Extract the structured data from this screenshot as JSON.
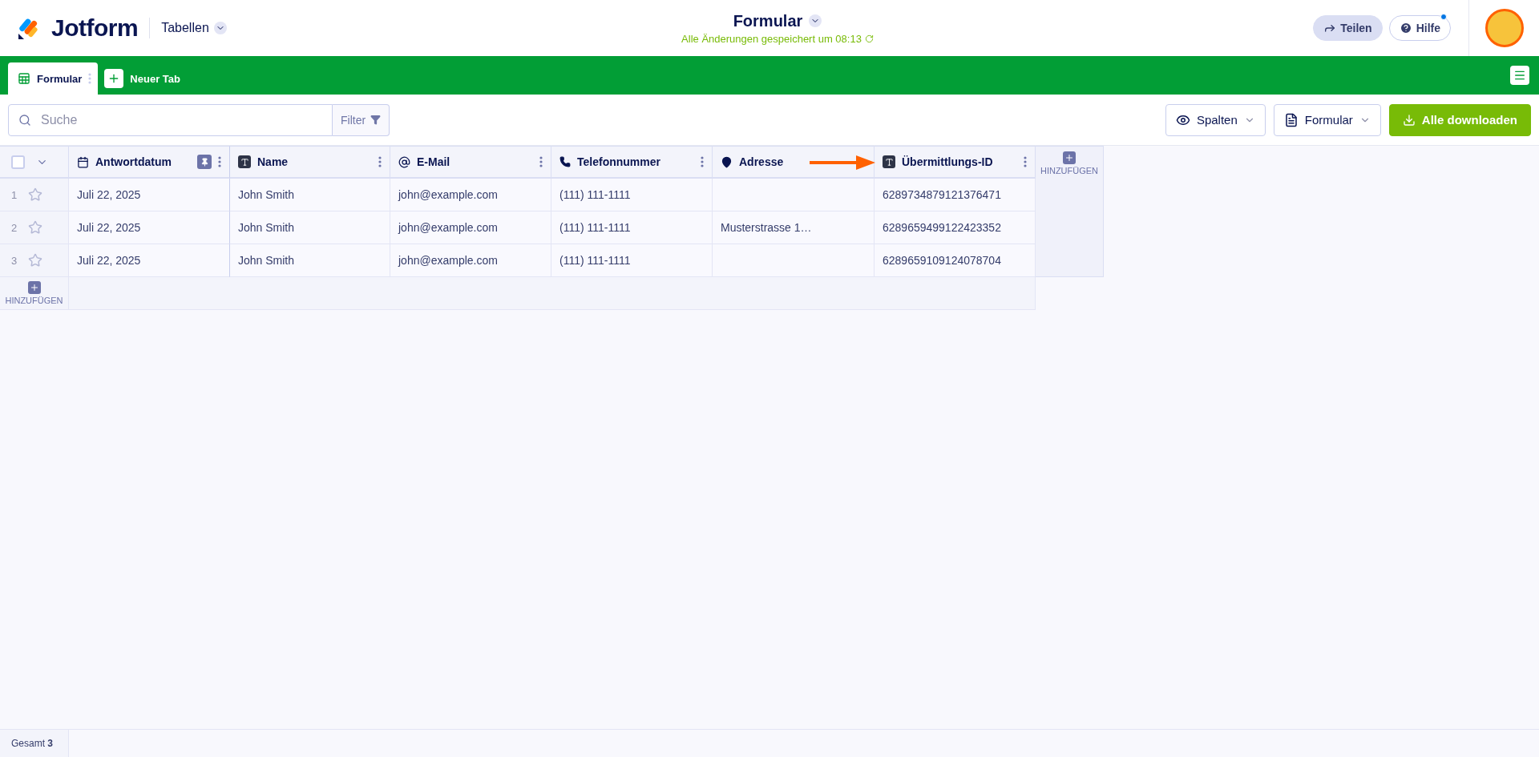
{
  "app": {
    "logo": "Jotform",
    "section": "Tabellen"
  },
  "form": {
    "title": "Formular",
    "save_status": "Alle Änderungen gespeichert um 08:13"
  },
  "header_buttons": [
    {
      "label": "Teilen",
      "kind": "share",
      "notification": false
    },
    {
      "label": "Hilfe",
      "kind": "help",
      "notification": true
    }
  ],
  "tabs": [
    {
      "label": "Formular",
      "selected": true
    }
  ],
  "new_tab": "Neuer Tab",
  "toolbar": {
    "search": {
      "placeholder": "Suche"
    },
    "filter": "Filter",
    "buttons": [
      {
        "label": "Spalten",
        "kind": "columns"
      },
      {
        "label": "Formular",
        "kind": "form"
      },
      {
        "label": "Alle downloaden",
        "kind": "download"
      }
    ]
  },
  "table": {
    "select_all_checked": false,
    "columns": [
      {
        "label": "Antwortdatum",
        "kind": "date",
        "pinned": true,
        "options_visible": true
      },
      {
        "label": "Name",
        "kind": "text",
        "pinned": false,
        "options_visible": true
      },
      {
        "label": "E-Mail",
        "kind": "email",
        "pinned": false,
        "options_visible": true
      },
      {
        "label": "Telefonnummer",
        "kind": "phone",
        "pinned": false,
        "options_visible": true
      },
      {
        "label": "Adresse",
        "kind": "address",
        "pinned": false,
        "options_visible": false
      },
      {
        "label": "Übermittlungs-ID",
        "kind": "text",
        "pinned": false,
        "options_visible": true
      }
    ],
    "rows": [
      {
        "number": "1",
        "starred": false,
        "cells": [
          "Juli 22, 2025",
          "John Smith",
          "john@example.com",
          "(111) 111-1111",
          "",
          "6289734879121376471"
        ]
      },
      {
        "number": "2",
        "starred": false,
        "cells": [
          "Juli 22, 2025",
          "John Smith",
          "john@example.com",
          "(111) 111-1111",
          "Musterstrasse 1…",
          "6289659499122423352"
        ]
      },
      {
        "number": "3",
        "starred": false,
        "cells": [
          "Juli 22, 2025",
          "John Smith",
          "john@example.com",
          "(111) 111-1111",
          "",
          "6289659109124078704"
        ]
      }
    ],
    "add_column": "HINZUFÜGEN",
    "add_row": "HINZUFÜGEN"
  },
  "status_bar": {
    "label": "Gesamt",
    "count": "3"
  }
}
